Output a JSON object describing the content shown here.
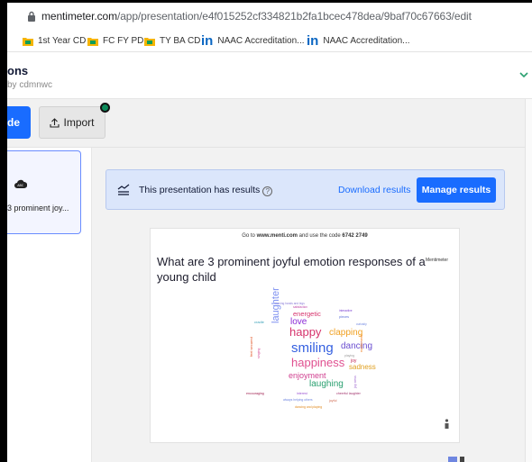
{
  "browser": {
    "url_host": "mentimeter.com",
    "url_path": "/app/presentation/e4f015252cf334821b2fa1bcec478dea/9baf70c67663/edit",
    "bookmarks": [
      {
        "label": "1st Year CD",
        "icon": "drive-folder-icon"
      },
      {
        "label": "FC FY PD",
        "icon": "drive-folder-icon"
      },
      {
        "label": "TY BA CD",
        "icon": "drive-folder-icon"
      },
      {
        "label": "NAAC Accreditation...",
        "icon": "linkedin-icon"
      },
      {
        "label": "NAAC Accreditation...",
        "icon": "linkedin-icon"
      }
    ]
  },
  "header": {
    "title_fragment": "ons",
    "owner_fragment": "by cdmnwc"
  },
  "toolbar": {
    "new_slide_fragment": "de",
    "import_label": "Import",
    "accent": "#196cff"
  },
  "slides_panel": {
    "slide_label": "3 prominent joy..."
  },
  "banner": {
    "message": "This presentation has results",
    "help_glyph": "?",
    "download_label": "Download results",
    "manage_label": "Manage results"
  },
  "slide": {
    "join_prefix": "Go to ",
    "join_site": "www.menti.com",
    "join_middle": " and use the code ",
    "join_code": "6742 2749",
    "logo_text": "Mentimeter",
    "question": "What are 3 prominent joyful emotion responses of a young child",
    "words": [
      {
        "text": "moving hands and legs",
        "color": "#8a7bd6"
      },
      {
        "text": "satisfaction",
        "color": "#c04aa8"
      },
      {
        "text": "interactive",
        "color": "#7a3fd1"
      },
      {
        "text": "energetic",
        "color": "#d6336c"
      },
      {
        "text": "pieces",
        "color": "#5a6fd8"
      },
      {
        "text": "love",
        "color": "#8a2bd6"
      },
      {
        "text": "curiosity",
        "color": "#6f86e0"
      },
      {
        "text": "cradle",
        "color": "#3aa0b8"
      },
      {
        "text": "happy",
        "color": "#d6336c"
      },
      {
        "text": "clapping",
        "color": "#f0a020"
      },
      {
        "text": "laughter",
        "color": "#7b8ef0"
      },
      {
        "text": "smiling",
        "color": "#3560e0"
      },
      {
        "text": "dancing",
        "color": "#6b4fd0"
      },
      {
        "text": "playing",
        "color": "#9a9a9a"
      },
      {
        "text": "joy",
        "color": "#c02050"
      },
      {
        "text": "happiness",
        "color": "#e05090"
      },
      {
        "text": "sadness",
        "color": "#e0a020"
      },
      {
        "text": "enjoyment",
        "color": "#d04090"
      },
      {
        "text": "laughing",
        "color": "#2aa070"
      },
      {
        "text": "encouraging",
        "color": "#a02050"
      },
      {
        "text": "interest",
        "color": "#9a4fd0"
      },
      {
        "text": "cheerful laughter",
        "color": "#a0306a"
      },
      {
        "text": "always helping others",
        "color": "#6f86e0"
      },
      {
        "text": "joyful",
        "color": "#d06a50"
      },
      {
        "text": "dancing and playing",
        "color": "#e08a20"
      },
      {
        "text": "feel secured",
        "color": "#e05020"
      },
      {
        "text": "singing",
        "color": "#d04090"
      },
      {
        "text": "excitement",
        "color": "#f08020"
      },
      {
        "text": "joy ness",
        "color": "#a06ad0"
      }
    ]
  }
}
